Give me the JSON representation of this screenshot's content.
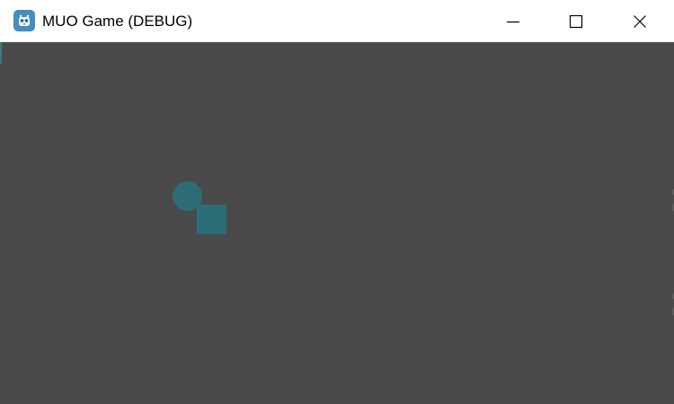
{
  "window": {
    "title": "MUO Game (DEBUG)",
    "icon": "godot-engine-icon",
    "controls": {
      "minimize": "minimize-icon",
      "maximize": "maximize-icon",
      "close": "close-icon"
    }
  },
  "scene": {
    "background_color": "#4a4a4a",
    "shapes": [
      {
        "kind": "circle",
        "color": "#2c6e77"
      },
      {
        "kind": "square",
        "color": "#2c6e77"
      }
    ]
  }
}
